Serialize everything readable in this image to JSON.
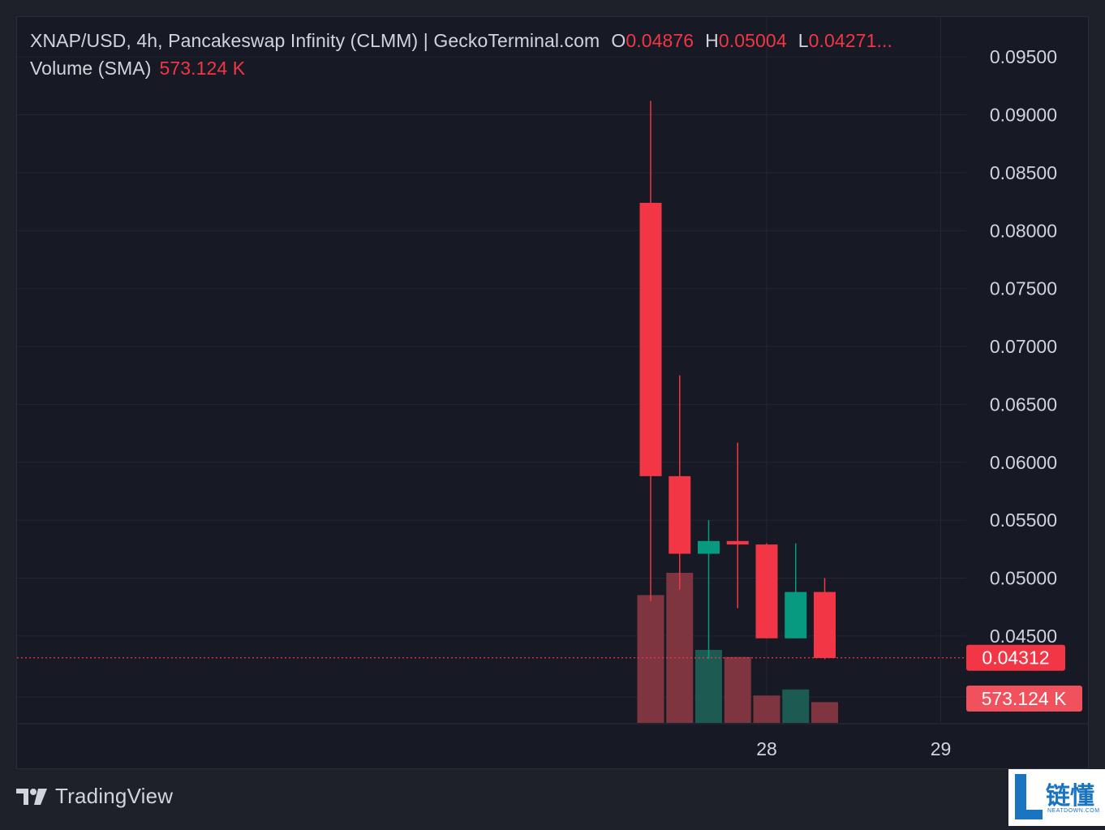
{
  "legend": {
    "title": "XNAP/USD, 4h, Pancakeswap Infinity (CLMM) | GeckoTerminal.com",
    "o_label": "O",
    "o_value": "0.04876",
    "h_label": "H",
    "h_value": "0.05004",
    "l_label": "L",
    "l_value": "0.04271...",
    "volume_label": "Volume (SMA)",
    "volume_value": "573.124 K"
  },
  "footer": {
    "brand": "TradingView"
  },
  "watermark": {
    "text": "链懂",
    "sub": "NEATDOWN.COM"
  },
  "colors": {
    "up": "#089981",
    "down": "#f23645",
    "vol_up": "#1d5b52",
    "vol_down": "#7e3540",
    "grid": "#232734",
    "axis_text": "#d1d4dc"
  },
  "chart_data": {
    "type": "candlestick",
    "ylim": [
      0.0424,
      0.0962
    ],
    "y_ticks": [
      "0.09500",
      "0.09000",
      "0.08500",
      "0.08000",
      "0.07500",
      "0.07000",
      "0.06500",
      "0.06000",
      "0.05500",
      "0.05000",
      "0.04500"
    ],
    "x_ticks": [
      {
        "label": "28",
        "index": 4.0
      },
      {
        "label": "29",
        "index": 10.0
      }
    ],
    "candles": [
      {
        "o": 0.0824,
        "h": 0.0912,
        "l": 0.048,
        "c": 0.0588
      },
      {
        "o": 0.0588,
        "h": 0.0675,
        "l": 0.049,
        "c": 0.0521
      },
      {
        "o": 0.0521,
        "h": 0.055,
        "l": 0.043,
        "c": 0.0532
      },
      {
        "o": 0.0532,
        "h": 0.0617,
        "l": 0.0474,
        "c": 0.0529
      },
      {
        "o": 0.0529,
        "h": 0.053,
        "l": 0.0448,
        "c": 0.0448
      },
      {
        "o": 0.0448,
        "h": 0.053,
        "l": 0.0448,
        "c": 0.0488
      },
      {
        "o": 0.0488,
        "h": 0.05,
        "l": 0.043,
        "c": 0.0431
      }
    ],
    "volume": [
      1260,
      1480,
      720,
      650,
      270,
      330,
      205
    ],
    "volume_max": 2000,
    "last_price_label": "0.04312",
    "last_price": 0.04312,
    "volume_label": "573.124 K"
  }
}
